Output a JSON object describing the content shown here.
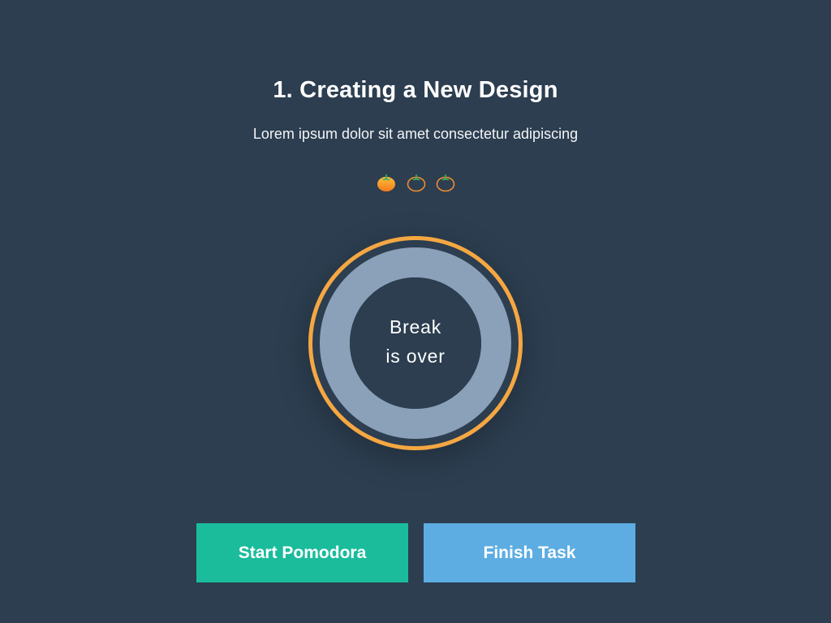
{
  "task": {
    "title": "1. Creating a New Design",
    "description": "Lorem ipsum dolor sit amet consectetur adipiscing"
  },
  "pomodoros": {
    "completed": 1,
    "total": 3,
    "icon": "tomato-icon"
  },
  "timer": {
    "line1": "Break",
    "line2": "is over",
    "progress": 1.0
  },
  "buttons": {
    "start_label": "Start Pomodora",
    "finish_label": "Finish Task"
  },
  "colors": {
    "background": "#2c3e50",
    "ring_outer": "#f5a742",
    "ring_track": "#8aa1b9",
    "start_button": "#1abc9c",
    "finish_button": "#5dade2"
  }
}
